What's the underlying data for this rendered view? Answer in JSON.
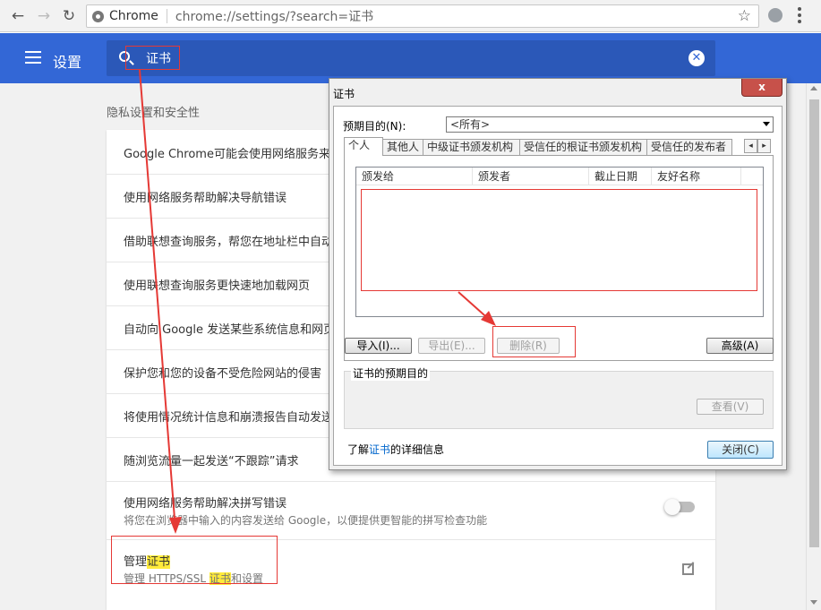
{
  "browser": {
    "site_name": "Chrome",
    "url": "chrome://settings/?search=证书"
  },
  "header": {
    "title": "设置",
    "search_query": "证书"
  },
  "section": {
    "title": "隐私设置和安全性"
  },
  "rows": [
    {
      "label": "Google Chrome可能会使用网络服务来改"
    },
    {
      "label": "使用网络服务帮助解决导航错误"
    },
    {
      "label": "借助联想查询服务，帮您在地址栏中自动"
    },
    {
      "label": "使用联想查询服务更快速地加载网页"
    },
    {
      "label": "自动向 Google 发送某些系统信息和网页"
    },
    {
      "label": "保护您和您的设备不受危险网站的侵害"
    },
    {
      "label": "将使用情况统计信息和崩溃报告自动发送"
    },
    {
      "label": "随浏览流量一起发送“不跟踪”请求"
    }
  ],
  "spell_row": {
    "label": "使用网络服务帮助解决拼写错误",
    "sub": "将您在浏览器中输入的内容发送给 Google，以便提供更智能的拼写检查功能"
  },
  "manage_row": {
    "label_prefix": "管理",
    "label_hl": "证书",
    "sub_prefix": "管理 HTTPS/SSL ",
    "sub_hl": "证书",
    "sub_suffix": "和设置"
  },
  "dialog": {
    "title": "证书",
    "close_glyph": "x",
    "purpose_label": "预期目的(N):",
    "purpose_value": "<所有>",
    "tabs": [
      "个人",
      "其他人",
      "中级证书颁发机构",
      "受信任的根证书颁发机构",
      "受信任的发布者"
    ],
    "tab_scroll_left": "◂",
    "tab_scroll_right": "▸",
    "columns": [
      "颁发给",
      "颁发者",
      "截止日期",
      "友好名称"
    ],
    "buttons": {
      "import": "导入(I)...",
      "export": "导出(E)...",
      "remove": "删除(R)",
      "advanced": "高级(A)",
      "view": "查看(V)",
      "close": "关闭(C)"
    },
    "group_label": "证书的预期目的",
    "learn_prefix": "了解",
    "learn_link": "证书",
    "learn_suffix": "的详细信息"
  },
  "colors": {
    "header_blue": "#3367d6",
    "annotation_red": "#e53935",
    "highlight_yellow": "#ffeb3b"
  }
}
